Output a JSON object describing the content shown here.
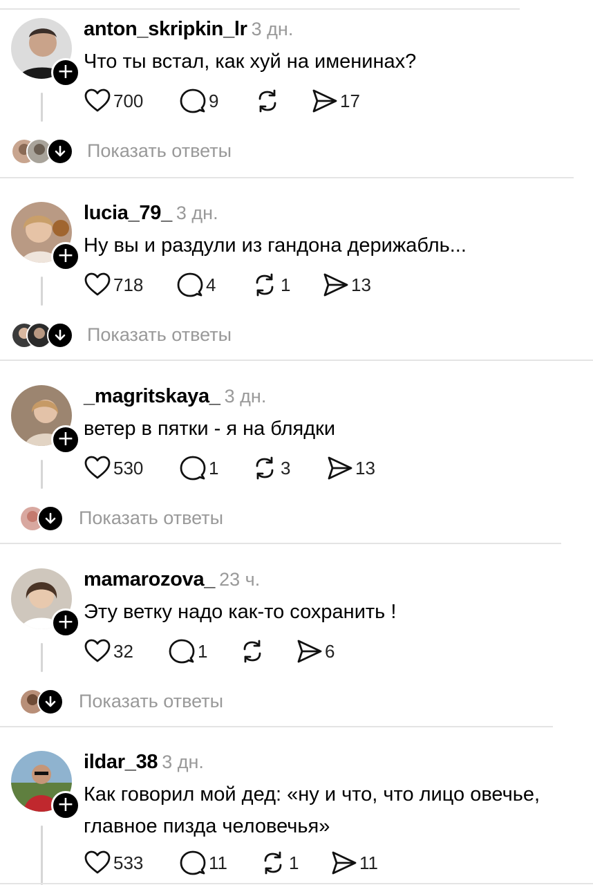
{
  "posts": [
    {
      "username": "anton_skripkin_lr",
      "time": "3 дн.",
      "text": [
        "Что ты встал, как хуй на именинах?"
      ],
      "likes": "700",
      "comments": "9",
      "reposts": "",
      "shares": "17",
      "show_replies": "Показать ответы"
    },
    {
      "username": "lucia_79_",
      "time": "3 дн.",
      "text": [
        "Ну вы и раздули из гандона дерижабль..."
      ],
      "likes": "718",
      "comments": "4",
      "reposts": "1",
      "shares": "13",
      "show_replies": "Показать ответы"
    },
    {
      "username": "_magritskaya_",
      "time": "3 дн.",
      "text": [
        "ветер в пятки - я на блядки"
      ],
      "likes": "530",
      "comments": "1",
      "reposts": "3",
      "shares": "13",
      "show_replies": "Показать ответы"
    },
    {
      "username": "mamarozova_",
      "time": "23 ч.",
      "text": [
        "Эту ветку надо как-то сохранить !"
      ],
      "likes": "32",
      "comments": "1",
      "reposts": "",
      "shares": "6",
      "show_replies": "Показать ответы"
    },
    {
      "username": "ildar_38",
      "time": "3 дн.",
      "text": [
        "Как говорил мой дед: «ну и что, что лицо овечье,",
        "главное пизда человечья»"
      ],
      "likes": "533",
      "comments": "11",
      "reposts": "1",
      "shares": "11",
      "show_replies": ""
    }
  ],
  "icons": {
    "follow": "plus-icon",
    "like": "heart-icon",
    "comment": "comment-bubble-icon",
    "repost": "repost-icon",
    "share": "send-icon",
    "replies": "arrow-down-icon"
  },
  "colors": {
    "text": "#000000",
    "muted": "#999999",
    "divider": "#e4e4e4",
    "thread_line": "#d6d6d6"
  }
}
